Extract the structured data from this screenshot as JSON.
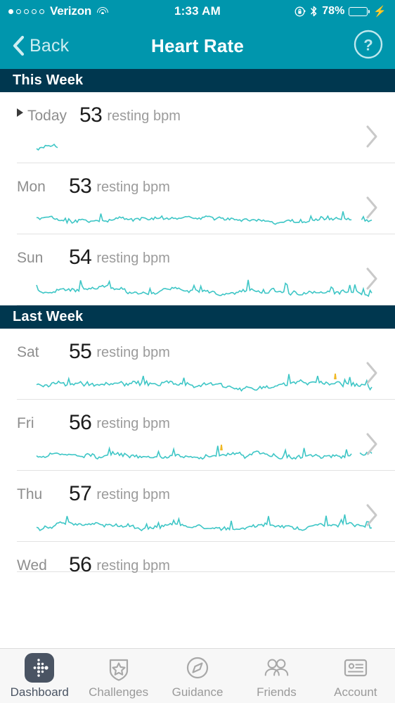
{
  "status_bar": {
    "carrier": "Verizon",
    "signal_dots_total": 5,
    "signal_dots_filled": 1,
    "wifi_icon": "wifi-icon",
    "time": "1:33 AM",
    "rotation_lock_icon": "rotation-lock-icon",
    "bluetooth_icon": "bluetooth-icon",
    "battery_percent": "78%",
    "battery_fill_pct": 78,
    "battery_color": "#4cd964",
    "charging_icon": "charging-bolt-icon"
  },
  "nav_bar": {
    "back_label": "Back",
    "back_icon": "chevron-left-icon",
    "title": "Heart Rate",
    "help_icon": "question-mark-circle-icon",
    "background_color": "#0096ad"
  },
  "unit_label": "resting bpm",
  "chart_data": {
    "type": "line",
    "title": "Heart Rate",
    "ylabel": "resting bpm",
    "series": [
      {
        "name": "Today",
        "resting_bpm": 53,
        "section": "This Week",
        "coverage": "partial"
      },
      {
        "name": "Mon",
        "resting_bpm": 53,
        "section": "This Week",
        "coverage": "full"
      },
      {
        "name": "Sun",
        "resting_bpm": 54,
        "section": "This Week",
        "coverage": "full"
      },
      {
        "name": "Sat",
        "resting_bpm": 55,
        "section": "Last Week",
        "coverage": "full"
      },
      {
        "name": "Fri",
        "resting_bpm": 56,
        "section": "Last Week",
        "coverage": "full"
      },
      {
        "name": "Thu",
        "resting_bpm": 57,
        "section": "Last Week",
        "coverage": "full"
      },
      {
        "name": "Wed",
        "resting_bpm": 56,
        "section": "Last Week",
        "coverage": "cut-off"
      }
    ],
    "line_color": "#3ec6c6",
    "peak_highlight_color": "#f0b823",
    "grid": false,
    "legend": "none"
  },
  "sections": [
    {
      "header": "This Week",
      "rows": [
        {
          "day": "Today",
          "value": "53",
          "unit": "resting bpm",
          "marker": true,
          "chevron": "chevron-right-icon"
        },
        {
          "day": "Mon",
          "value": "53",
          "unit": "resting bpm",
          "marker": false,
          "chevron": "chevron-right-icon"
        },
        {
          "day": "Sun",
          "value": "54",
          "unit": "resting bpm",
          "marker": false,
          "chevron": "chevron-right-icon"
        }
      ]
    },
    {
      "header": "Last Week",
      "rows": [
        {
          "day": "Sat",
          "value": "55",
          "unit": "resting bpm",
          "marker": false,
          "chevron": "chevron-right-icon"
        },
        {
          "day": "Fri",
          "value": "56",
          "unit": "resting bpm",
          "marker": false,
          "chevron": "chevron-right-icon"
        },
        {
          "day": "Thu",
          "value": "57",
          "unit": "resting bpm",
          "marker": false,
          "chevron": "chevron-right-icon"
        },
        {
          "day": "Wed",
          "value": "56",
          "unit": "resting bpm",
          "marker": false,
          "chevron": "chevron-right-icon"
        }
      ]
    }
  ],
  "tab_bar": {
    "items": [
      {
        "label": "Dashboard",
        "icon": "fitbit-dots-icon",
        "active": true
      },
      {
        "label": "Challenges",
        "icon": "shield-star-icon",
        "active": false
      },
      {
        "label": "Guidance",
        "icon": "compass-icon",
        "active": false
      },
      {
        "label": "Friends",
        "icon": "two-people-icon",
        "active": false
      },
      {
        "label": "Account",
        "icon": "id-card-icon",
        "active": false
      }
    ]
  }
}
